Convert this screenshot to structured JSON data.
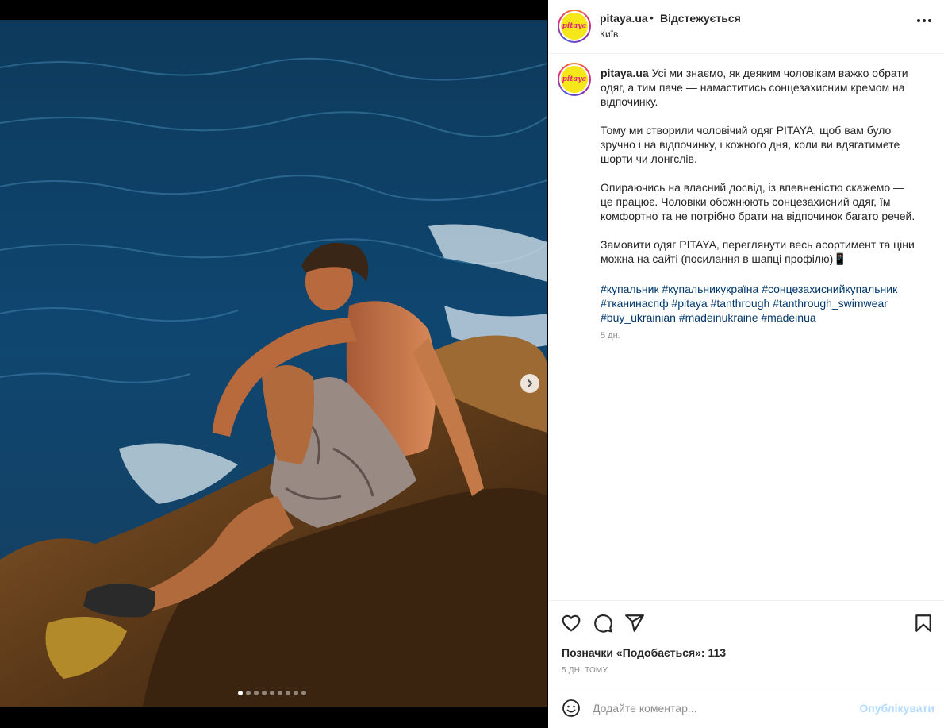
{
  "post": {
    "username": "pitaya.ua",
    "separator": "•",
    "follow_label": "Відстежується",
    "location": "Київ",
    "avatar_text": "pitaya",
    "more_icon": "more-horizontal-icon"
  },
  "caption": {
    "username": "pitaya.ua",
    "text": " Усі ми знаємо, як деяким чоловікам важко обрати одяг, а тим паче — намаститись сонцезахисним кремом на відпочинку.\n\nТому ми створили чоловічий одяг PITAYA, щоб вам було зручно і на відпочинку, і кожного дня, коли ви вдягатимете шорти чи лонгслів.\n\nОпираючись на власний досвід, із впевненістю скажемо — це працює. Чоловіки обожнюють сонцезахисний одяг, їм комфортно та не потрібно брати на відпочинок багато речей.\n\nЗамовити одяг PITAYA, переглянути весь асортимент та ціни можна на сайті (посилання в шапці профілю)📱",
    "hashtags": [
      "#купальник",
      "#купальникукраїна",
      "#сонцезахиснийкупальник",
      "#тканинаспф",
      "#pitaya",
      "#tanthrough",
      "#tanthrough_swimwear",
      "#buy_ukrainian",
      "#madeinukraine",
      "#madeinua"
    ],
    "time": "5 дн."
  },
  "carousel": {
    "slides": 9,
    "active_index": 0
  },
  "actions": {
    "icons": [
      "heart-icon",
      "comment-icon",
      "share-icon",
      "bookmark-icon"
    ],
    "likes_label": "Позначки «Подобається»: 113",
    "time_ago": "5 ДН. ТОМУ"
  },
  "comment": {
    "placeholder": "Додайте коментар...",
    "publish_label": "Опублікувати"
  },
  "colors": {
    "link": "#00376b",
    "publish_disabled": "#b3dbff",
    "secondary_text": "#8e8e8e",
    "brand_yellow": "#f6e71a",
    "brand_pink": "#e0287b"
  }
}
